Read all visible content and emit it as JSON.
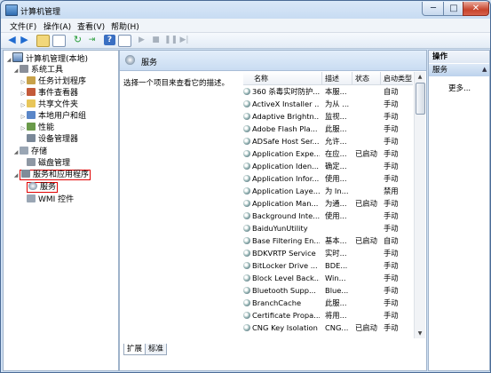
{
  "window": {
    "title": "计算机管理",
    "min": "─",
    "max": "□",
    "close": "✕"
  },
  "menu": [
    "文件(F)",
    "操作(A)",
    "查看(V)",
    "帮助(H)"
  ],
  "toolbar": {
    "icons": [
      "back-icon",
      "forward-icon",
      "up-folder-icon",
      "show-hide-tree-icon",
      "refresh-icon",
      "export-icon",
      "help-icon",
      "properties-icon",
      "start-icon",
      "stop-icon",
      "pause-icon",
      "restart-icon"
    ]
  },
  "tree": {
    "root": "计算机管理(本地)",
    "system_tools": "系统工具",
    "task_scheduler": "任务计划程序",
    "event_viewer": "事件查看器",
    "shared_folders": "共享文件夹",
    "local_users": "本地用户和组",
    "performance": "性能",
    "device_manager": "设备管理器",
    "storage": "存储",
    "disk_management": "磁盘管理",
    "services_apps": "服务和应用程序",
    "services": "服务",
    "wmi": "WMI 控件"
  },
  "center": {
    "title": "服务",
    "description": "选择一个项目来查看它的描述。"
  },
  "grid": {
    "headers": [
      "名称",
      "描述",
      "状态",
      "启动类型"
    ],
    "rows": [
      [
        "360 杀毒实时防护...",
        "本服...",
        "",
        "自动"
      ],
      [
        "ActiveX Installer ...",
        "为从 ...",
        "",
        "手动"
      ],
      [
        "Adaptive Brightn...",
        "监视...",
        "",
        "手动"
      ],
      [
        "Adobe Flash Pla...",
        "此服...",
        "",
        "手动"
      ],
      [
        "ADSafe Host Ser...",
        "允许...",
        "",
        "手动"
      ],
      [
        "Application Expe...",
        "在应...",
        "已启动",
        "手动"
      ],
      [
        "Application Iden...",
        "确定...",
        "",
        "手动"
      ],
      [
        "Application Infor...",
        "使用...",
        "",
        "手动"
      ],
      [
        "Application Laye...",
        "为 In...",
        "",
        "禁用"
      ],
      [
        "Application Man...",
        "为通...",
        "已启动",
        "手动"
      ],
      [
        "Background Inte...",
        "使用...",
        "",
        "手动"
      ],
      [
        "BaiduYunUtility",
        "",
        "",
        "手动"
      ],
      [
        "Base Filtering En...",
        "基本...",
        "已启动",
        "自动"
      ],
      [
        "BDKVRTP Service",
        "实时...",
        "",
        "手动"
      ],
      [
        "BitLocker Drive ...",
        "BDE...",
        "",
        "手动"
      ],
      [
        "Block Level Back...",
        "Win...",
        "",
        "手动"
      ],
      [
        "Bluetooth Supp...",
        "Blue...",
        "",
        "手动"
      ],
      [
        "BranchCache",
        "此服...",
        "",
        "手动"
      ],
      [
        "Certificate Propa...",
        "将用...",
        "",
        "手动"
      ],
      [
        "CNG Key Isolation",
        "CNG...",
        "已启动",
        "手动"
      ]
    ]
  },
  "tabs": [
    "扩展",
    "标准"
  ],
  "actions": {
    "title": "操作",
    "section": "服务",
    "more": "更多..."
  }
}
